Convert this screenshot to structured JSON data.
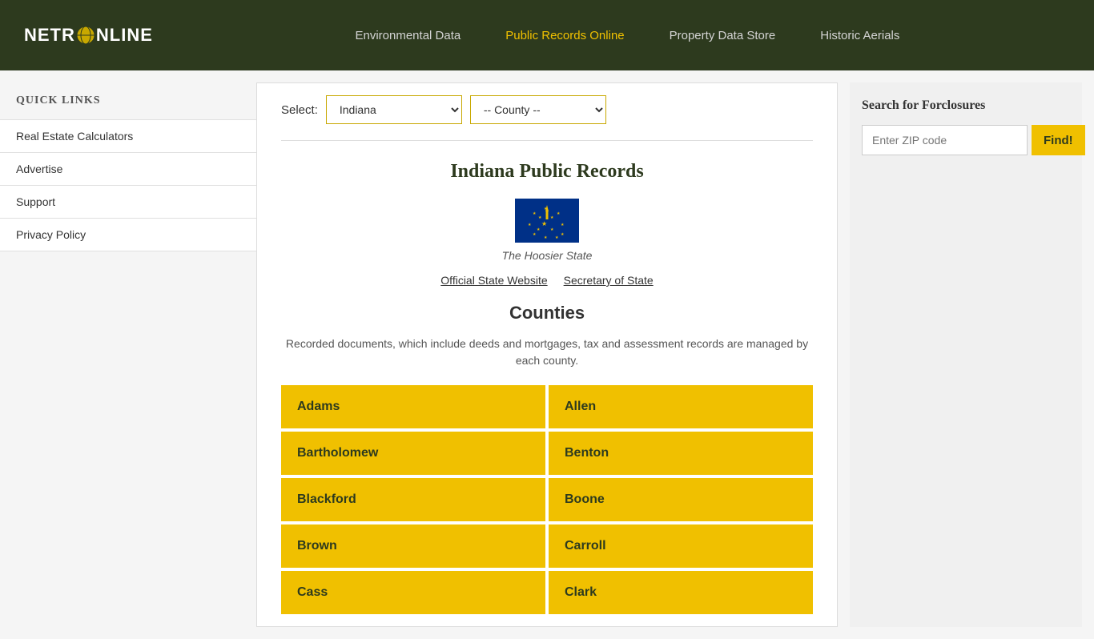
{
  "header": {
    "logo_text": "NETR",
    "logo_globe": "O",
    "logo_suffix": "NLINE",
    "nav": [
      {
        "label": "Environmental Data",
        "id": "env-data",
        "active": false
      },
      {
        "label": "Public Records Online",
        "id": "public-records",
        "active": true
      },
      {
        "label": "Property Data Store",
        "id": "property-data",
        "active": false
      },
      {
        "label": "Historic Aerials",
        "id": "historic-aerials",
        "active": false
      }
    ]
  },
  "sidebar": {
    "title": "Quick Links",
    "links": [
      {
        "label": "Real Estate Calculators"
      },
      {
        "label": "Advertise"
      },
      {
        "label": "Support"
      },
      {
        "label": "Privacy Policy"
      }
    ]
  },
  "select_bar": {
    "label": "Select:",
    "state_placeholder": "Indiana",
    "county_placeholder": "-- County --"
  },
  "main": {
    "page_title": "Indiana Public Records",
    "state_nickname": "The Hoosier State",
    "official_state_link": "Official State Website",
    "secretary_link": "Secretary of State",
    "counties_title": "Counties",
    "counties_desc": "Recorded documents, which include deeds and mortgages, tax and assessment records are managed by each county.",
    "counties": [
      {
        "name": "Adams"
      },
      {
        "name": "Allen"
      },
      {
        "name": "Bartholomew"
      },
      {
        "name": "Benton"
      },
      {
        "name": "Blackford"
      },
      {
        "name": "Boone"
      },
      {
        "name": "Brown"
      },
      {
        "name": "Carroll"
      },
      {
        "name": "Cass"
      },
      {
        "name": "Clark"
      }
    ]
  },
  "right_sidebar": {
    "title": "Search for Forclosures",
    "input_placeholder": "Enter ZIP code",
    "button_label": "Find!"
  }
}
